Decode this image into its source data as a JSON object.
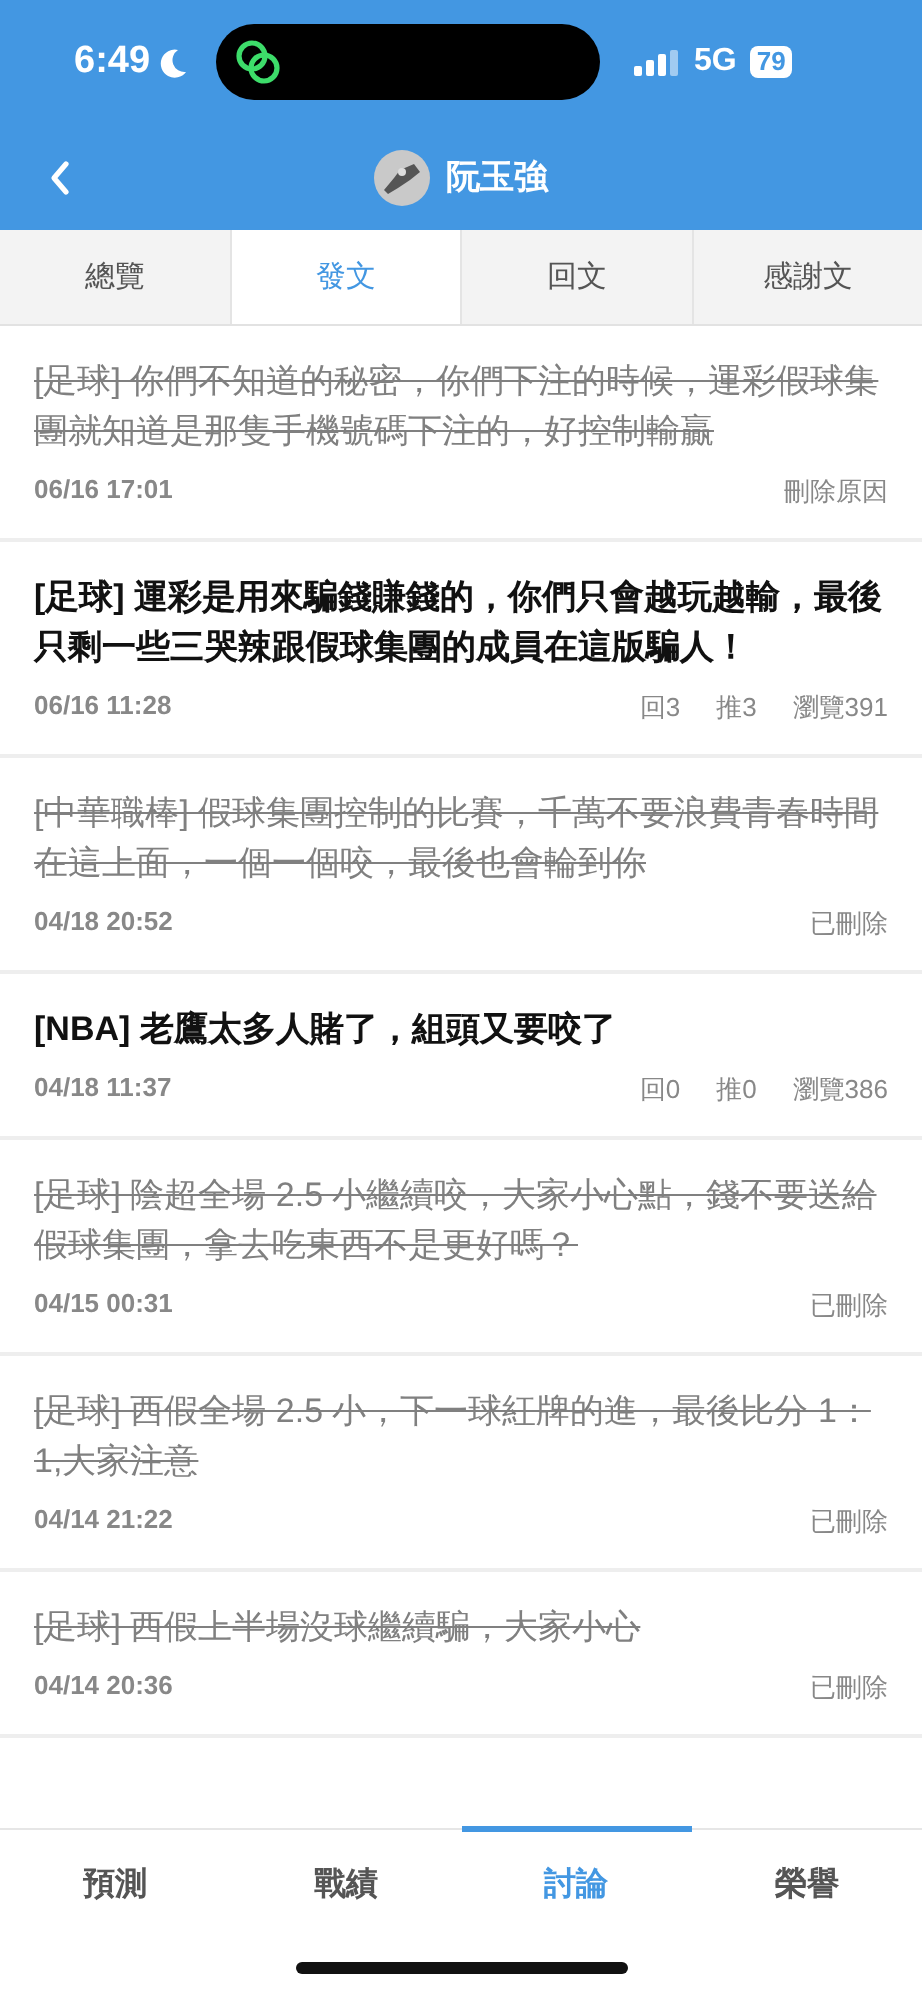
{
  "status_bar": {
    "time": "6:49",
    "network": "5G",
    "battery": "79"
  },
  "header": {
    "title": "阮玉強"
  },
  "tabs": [
    {
      "label": "總覽",
      "selected": false
    },
    {
      "label": "發文",
      "selected": true
    },
    {
      "label": "回文",
      "selected": false
    },
    {
      "label": "感謝文",
      "selected": false
    }
  ],
  "posts": [
    {
      "title": "[足球] 你們不知道的秘密，你們下注的時候，運彩假球集團就知道是那隻手機號碼下注的，好控制輸贏",
      "time": "06/16 17:01",
      "deleted": true,
      "status": "刪除原因"
    },
    {
      "title": "[足球] 運彩是用來騙錢賺錢的，你們只會越玩越輸，最後只剩一些三哭辣跟假球集團的成員在這版騙人！",
      "time": "06/16 11:28",
      "deleted": false,
      "replies": "回3",
      "likes": "推3",
      "views": "瀏覽391"
    },
    {
      "title": "[中華職棒] 假球集團控制的比賽，千萬不要浪費青春時間在這上面，一個一個咬，最後也會輪到你",
      "time": "04/18 20:52",
      "deleted": true,
      "status": "已刪除"
    },
    {
      "title": "[NBA] 老鷹太多人賭了，組頭又要咬了",
      "time": "04/18 11:37",
      "deleted": false,
      "replies": "回0",
      "likes": "推0",
      "views": "瀏覽386"
    },
    {
      "title": "[足球] 陰超全場 2.5 小繼續咬，大家小心點，錢不要送給假球集團，拿去吃東西不是更好嗎？",
      "time": "04/15 00:31",
      "deleted": true,
      "status": "已刪除"
    },
    {
      "title": "[足球] 西假全場 2.5 小，下一球紅牌的進，最後比分 1：1,大家注意",
      "time": "04/14 21:22",
      "deleted": true,
      "status": "已刪除"
    },
    {
      "title": "[足球] 西假上半場沒球繼續騙，大家小心",
      "time": "04/14 20:36",
      "deleted": true,
      "status": "已刪除"
    }
  ],
  "bottom_nav": [
    {
      "label": "預測",
      "selected": false
    },
    {
      "label": "戰績",
      "selected": false
    },
    {
      "label": "討論",
      "selected": true
    },
    {
      "label": "榮譽",
      "selected": false
    }
  ]
}
